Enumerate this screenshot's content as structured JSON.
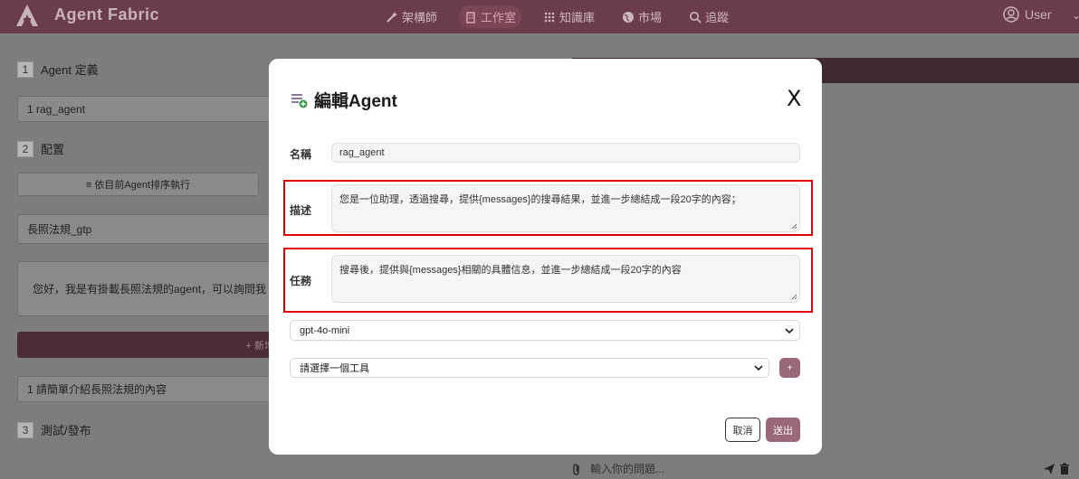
{
  "navbar": {
    "brand": "Agent Fabric",
    "items": [
      {
        "label": "架構師",
        "icon": "wand-icon"
      },
      {
        "label": "工作室",
        "icon": "building-icon",
        "active": true
      },
      {
        "label": "知識庫",
        "icon": "grid-icon"
      },
      {
        "label": "市場",
        "icon": "globe-icon"
      },
      {
        "label": "追蹤",
        "icon": "search-icon"
      }
    ],
    "user_label": "User"
  },
  "background": {
    "step1": {
      "num": "1",
      "label": "Agent 定義"
    },
    "agent_name": "1  rag_agent",
    "step2": {
      "num": "2",
      "label": "配置"
    },
    "order_button": "≡ 依目前Agent排序執行",
    "agent_item": "長照法規_gtp",
    "greeting": "您好，我是有掛載長照法規的agent，可以詢問我",
    "add_button": "+ 新增",
    "prompt_item": "1  請簡單介紹長照法規的內容",
    "step3": {
      "num": "3",
      "label": "測試/發布"
    },
    "chat_placeholder": "輸入你的問題..."
  },
  "modal": {
    "title": "編輯Agent",
    "close_label": "X",
    "name_label": "名稱",
    "name_value": "rag_agent",
    "description_label": "描述",
    "description_value": "您是一位助理，透過搜尋，提供{messages}的搜尋結果，並進一步總結成一段20字的內容；",
    "task_label": "任務",
    "task_value": "搜尋後，提供與{messages}相關的具體信息，並進一步總結成一段20字的內容",
    "model_value": "gpt-4o-mini",
    "tool_placeholder": "請選擇一個工具",
    "plus_label": "+",
    "cancel_label": "取消",
    "submit_label": "送出"
  },
  "colors": {
    "brand": "#6b3d4b",
    "accent": "#9a6877",
    "highlight": "#e10000"
  }
}
